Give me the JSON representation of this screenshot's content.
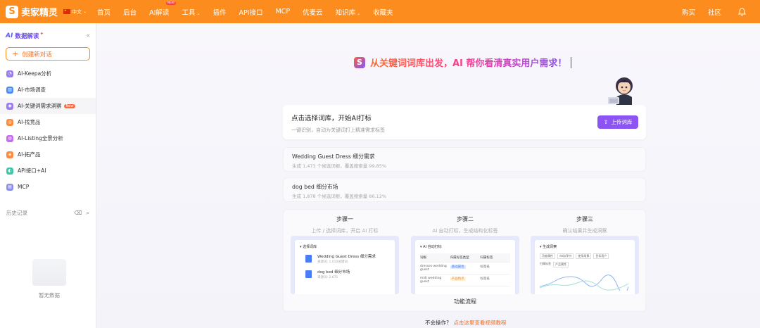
{
  "brand": {
    "name": "卖家精灵",
    "logo_letter": "S"
  },
  "lang": "中文",
  "nav": [
    {
      "label": "首页"
    },
    {
      "label": "后台"
    },
    {
      "label": "AI解读",
      "badge": "NEW"
    },
    {
      "label": "工具",
      "caret": "⌄"
    },
    {
      "label": "插件"
    },
    {
      "label": "API接口"
    },
    {
      "label": "MCP"
    },
    {
      "label": "优麦云"
    },
    {
      "label": "知识库",
      "caret": "⌄"
    },
    {
      "label": "收藏夹"
    }
  ],
  "nav_right": {
    "buy": "购买",
    "community": "社区"
  },
  "sidebar": {
    "ai_logo": "AI",
    "title": "数据解读",
    "sparkle": "✦",
    "collapse": "«",
    "new_chat": "创建新对话",
    "items": [
      {
        "label": "AI-Keepa分析",
        "color": "#9b7bf0",
        "icon": "◔"
      },
      {
        "label": "AI-市场调查",
        "color": "#4a8af6",
        "icon": "▥"
      },
      {
        "label": "AI-关键词需求洞察",
        "color": "#9b7bf0",
        "icon": "◉",
        "badge": "New"
      },
      {
        "label": "AI-找竞品",
        "color": "#ff8a3d",
        "icon": "◎"
      },
      {
        "label": "AI-Listing全景分析",
        "color": "#c76bf0",
        "icon": "◍"
      },
      {
        "label": "AI-拓产品",
        "color": "#ff8a3d",
        "icon": "◈"
      },
      {
        "label": "API接口+AI",
        "color": "#3fc5a8",
        "icon": "◐"
      },
      {
        "label": "MCP",
        "color": "#8e8ee8",
        "icon": "▤"
      }
    ],
    "history": "历史记录",
    "empty": "暂无数据"
  },
  "hero": {
    "text": "从关键词词库出发，AI 帮你看清真实用户需求！",
    "logo_letter": "S"
  },
  "select_card": {
    "title": "点击选择词库，开始AI打标",
    "subtitle": "一键识别，自动为关键词打上精准需求标签",
    "upload": "上传词库"
  },
  "recents": [
    {
      "title": "Wedding Guest Dress 细分需求",
      "sub": "生成 1,473 个候选词根，覆盖搜索量 99.85%"
    },
    {
      "title": "dog bed 细分市场",
      "sub": "生成 1,878 个候选词根，覆盖搜索量 86.12%"
    }
  ],
  "steps": [
    {
      "title": "步骤一",
      "sub": "上传 / 选择词库，开启 AI 打标",
      "shot_header": "选择词库",
      "items": [
        {
          "t": "Wedding Guest Dress 细分需求",
          "s": "来源词: 1,010关键词"
        },
        {
          "t": "dog bed 细分市场",
          "s": "来源词: 2,671"
        }
      ]
    },
    {
      "title": "步骤二",
      "sub": "AI 自动打标，生成结构化标签",
      "shot_header": "AI 自动打标",
      "cols": [
        "词根",
        "归属标签类型",
        "归属标签"
      ],
      "rows": [
        [
          "dresses wedding guest",
          "基础属性",
          "标签名"
        ],
        [
          "midi wedding guest",
          "产品特点",
          "标签名"
        ]
      ]
    },
    {
      "title": "步骤三",
      "sub": "确认结果并生成洞察",
      "shot_header": "生成洞察",
      "chips": [
        "功能属性",
        "市场/季节",
        "使用场景",
        "目标用户",
        "品类名称"
      ],
      "chips2": [
        "归属标签",
        "",
        "产品属性"
      ]
    }
  ],
  "flow_label": "功能流程",
  "help": {
    "text": "不会操作?",
    "link": "点击这里查看视频教程"
  }
}
